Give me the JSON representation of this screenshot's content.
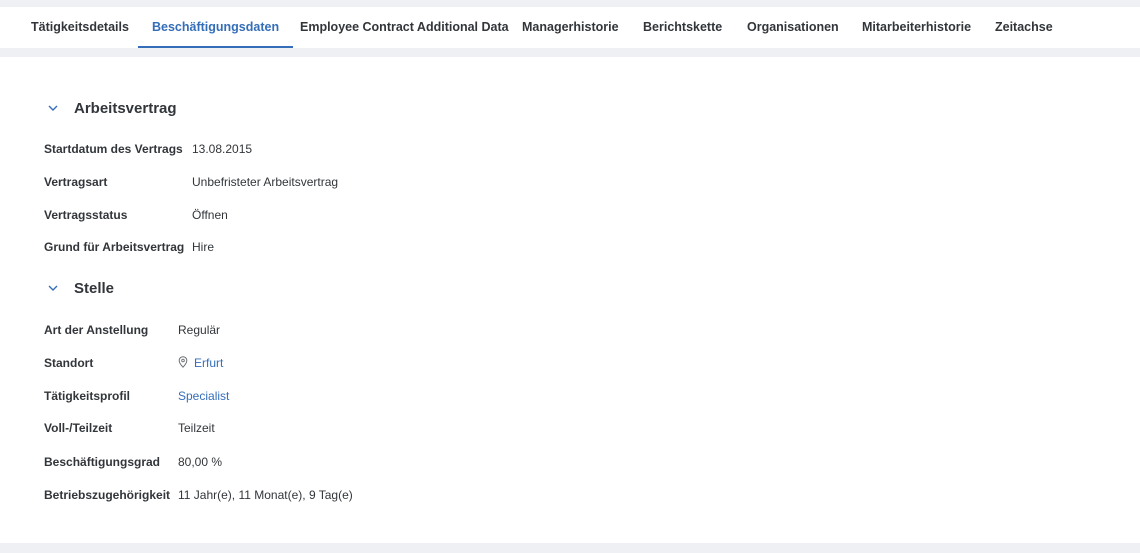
{
  "tabs": [
    {
      "label": "Tätigkeitsdetails",
      "active": false
    },
    {
      "label": "Beschäftigungsdaten",
      "active": true
    },
    {
      "label": "Employee Contract Additional Data",
      "active": false
    },
    {
      "label": "Managerhistorie",
      "active": false
    },
    {
      "label": "Berichtskette",
      "active": false
    },
    {
      "label": "Organisationen",
      "active": false
    },
    {
      "label": "Mitarbeiterhistorie",
      "active": false
    },
    {
      "label": "Zeitachse",
      "active": false
    }
  ],
  "contract": {
    "title": "Arbeitsvertrag",
    "fields": [
      {
        "label": "Startdatum des Vertrags",
        "value": "13.08.2015"
      },
      {
        "label": "Vertragsart",
        "value": "Unbefristeter Arbeitsvertrag"
      },
      {
        "label": "Vertragsstatus",
        "value": "Öffnen"
      },
      {
        "label": "Grund für Arbeitsvertrag",
        "value": "Hire"
      }
    ]
  },
  "position": {
    "title": "Stelle",
    "fields": [
      {
        "label": "Art der Anstellung",
        "value": "Regulär"
      },
      {
        "label": "Standort",
        "value": "Erfurt"
      },
      {
        "label": "Tätigkeitsprofil",
        "value": "Specialist"
      },
      {
        "label": "Voll-/Teilzeit",
        "value": "Teilzeit"
      },
      {
        "label": "Beschäftigungsgrad",
        "value": "80,00 %"
      },
      {
        "label": "Betriebszugehörigkeit",
        "value": "11 Jahr(e), 11 Monat(e), 9 Tag(e)"
      }
    ]
  },
  "colors": {
    "accent": "#346eb8",
    "text": "#32363a",
    "background": "#f3f4f6"
  }
}
